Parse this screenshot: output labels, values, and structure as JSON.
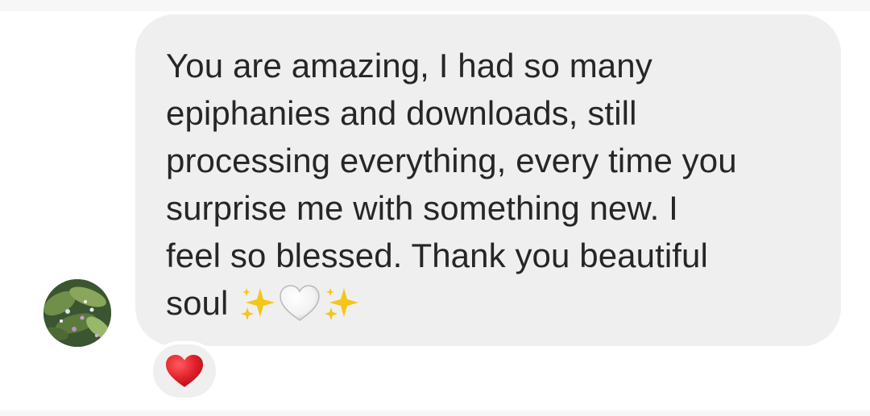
{
  "message": {
    "text": "You are amazing, I had so many\nepiphanies and downloads, still\nprocessing everything, every time you\nsurprise me with something new. I\nfeel so blessed. Thank you beautiful\nsoul",
    "trailing_emojis": [
      "sparkles-icon",
      "white-heart-icon",
      "sparkles-icon"
    ]
  },
  "reaction": {
    "emoji": "red-heart-icon"
  },
  "colors": {
    "bubble": "#efefef",
    "text": "#262626",
    "reaction_heart": "#e0202a",
    "sparkles": "#f5c518"
  }
}
